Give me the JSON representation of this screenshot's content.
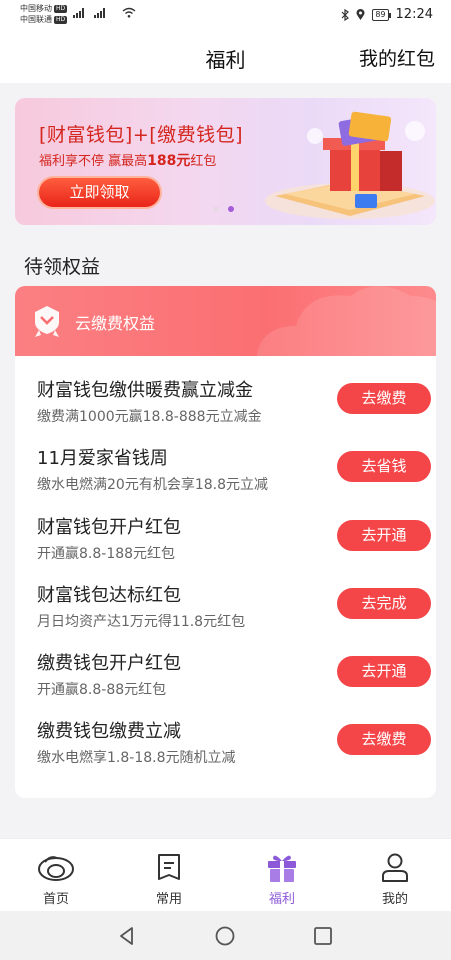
{
  "status_bar": {
    "carrier1": "中国移动",
    "carrier2": "中国联通",
    "hd": "HD",
    "net1": "4G",
    "net2": "4G",
    "battery": "89",
    "time": "12:24"
  },
  "header": {
    "title": "福利",
    "my_red_packet": "我的红包"
  },
  "banner": {
    "title": "[财富钱包]+[缴费钱包]",
    "subtitle_prefix": "福利享不停 赢最高",
    "subtitle_amount": "188元",
    "subtitle_suffix": "红包",
    "button": "立即领取",
    "active_slide": 2,
    "slide_count": 2
  },
  "section": {
    "title": "待领权益",
    "card_title": "云缴费权益"
  },
  "items": [
    {
      "title": "财富钱包缴供暖费赢立减金",
      "desc": "缴费满1000元赢18.8-888元立减金",
      "button": "去缴费"
    },
    {
      "title": "11月爱家省钱周",
      "desc": "缴水电燃满20元有机会享18.8元立减",
      "button": "去省钱"
    },
    {
      "title": "财富钱包开户红包",
      "desc": "开通赢8.8-188元红包",
      "button": "去开通"
    },
    {
      "title": "财富钱包达标红包",
      "desc": "月日均资产达1万元得11.8元红包",
      "button": "去完成"
    },
    {
      "title": "缴费钱包开户红包",
      "desc": "开通赢8.8-88元红包",
      "button": "去开通"
    },
    {
      "title": "缴费钱包缴费立减",
      "desc": "缴水电燃享1.8-18.8元随机立减",
      "button": "去缴费"
    }
  ],
  "bottom_nav": [
    {
      "label": "首页",
      "icon": "home-cloud-icon"
    },
    {
      "label": "常用",
      "icon": "document-icon"
    },
    {
      "label": "福利",
      "icon": "gift-icon",
      "active": true
    },
    {
      "label": "我的",
      "icon": "user-icon"
    }
  ],
  "colors": {
    "accent": "#8c5ad8",
    "button_red": "#f44548",
    "banner_red": "#d4261e"
  }
}
